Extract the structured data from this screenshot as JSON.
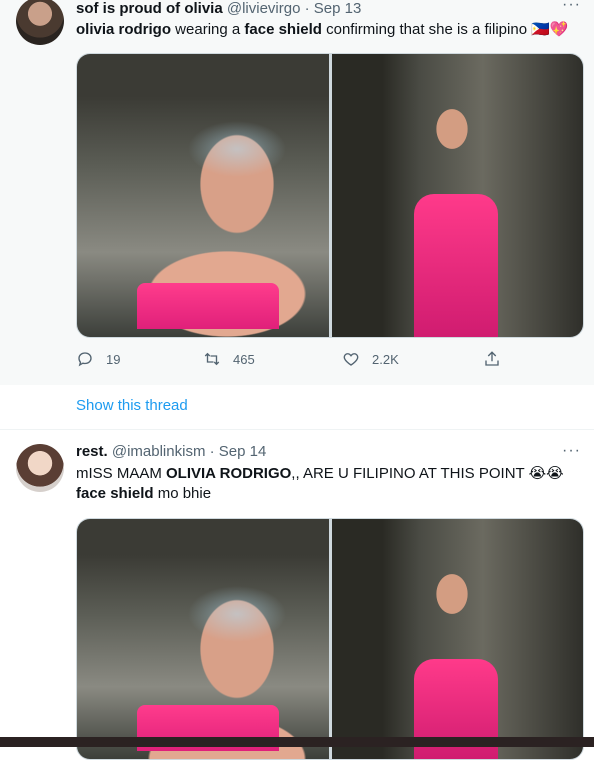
{
  "tweets": [
    {
      "author_name": "sof is proud of olivia",
      "handle": "@livievirgo",
      "dot": "·",
      "date": "Sep 13",
      "text_parts": [
        "olivia rodrigo",
        " wearing a ",
        "face shield",
        " confirming that she is a filipino ",
        "🇵🇭💖"
      ],
      "actions": {
        "replies": "19",
        "retweets": "465",
        "likes": "2.2K"
      },
      "show_thread_label": "Show this thread"
    },
    {
      "author_name": "rest.",
      "handle": "@imablinkism",
      "dot": "·",
      "date": "Sep 14",
      "line1_parts": [
        "mISS MAAM ",
        "OLIVIA RODRIGO",
        ",, ARE U FILIPINO AT THIS POINT ",
        "😭😭"
      ],
      "line2_parts": [
        "face shield",
        " mo bhie"
      ]
    }
  ],
  "icons": {
    "more": "more-horizontal-icon",
    "reply": "reply-icon",
    "retweet": "retweet-icon",
    "like": "heart-icon",
    "share": "share-icon"
  },
  "colors": {
    "link": "#1d9bf0",
    "secondary": "#536471"
  }
}
